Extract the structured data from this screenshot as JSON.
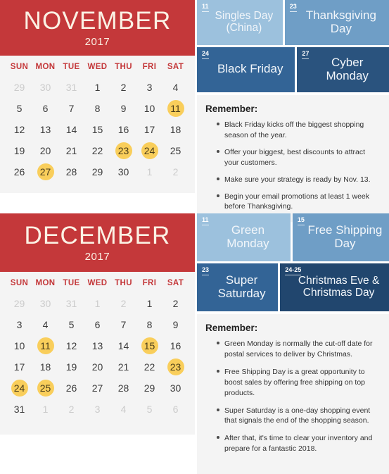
{
  "months": [
    {
      "id": "november",
      "name": "NOVEMBER",
      "year": "2017",
      "dow": [
        "SUN",
        "MON",
        "TUE",
        "WED",
        "THU",
        "FRI",
        "SAT"
      ],
      "weeks": [
        [
          {
            "n": "29",
            "state": "muted"
          },
          {
            "n": "30",
            "state": "muted"
          },
          {
            "n": "31",
            "state": "muted"
          },
          {
            "n": "1",
            "state": "normal"
          },
          {
            "n": "2",
            "state": "normal"
          },
          {
            "n": "3",
            "state": "normal"
          },
          {
            "n": "4",
            "state": "normal"
          }
        ],
        [
          {
            "n": "5",
            "state": "normal"
          },
          {
            "n": "6",
            "state": "normal"
          },
          {
            "n": "7",
            "state": "normal"
          },
          {
            "n": "8",
            "state": "normal"
          },
          {
            "n": "9",
            "state": "normal"
          },
          {
            "n": "10",
            "state": "normal"
          },
          {
            "n": "11",
            "state": "highlight"
          }
        ],
        [
          {
            "n": "12",
            "state": "normal"
          },
          {
            "n": "13",
            "state": "normal"
          },
          {
            "n": "14",
            "state": "normal"
          },
          {
            "n": "15",
            "state": "normal"
          },
          {
            "n": "16",
            "state": "normal"
          },
          {
            "n": "17",
            "state": "normal"
          },
          {
            "n": "18",
            "state": "normal"
          }
        ],
        [
          {
            "n": "19",
            "state": "normal"
          },
          {
            "n": "20",
            "state": "normal"
          },
          {
            "n": "21",
            "state": "normal"
          },
          {
            "n": "22",
            "state": "normal"
          },
          {
            "n": "23",
            "state": "highlight"
          },
          {
            "n": "24",
            "state": "highlight"
          },
          {
            "n": "25",
            "state": "normal"
          }
        ],
        [
          {
            "n": "26",
            "state": "normal"
          },
          {
            "n": "27",
            "state": "highlight"
          },
          {
            "n": "28",
            "state": "normal"
          },
          {
            "n": "29",
            "state": "normal"
          },
          {
            "n": "30",
            "state": "normal"
          },
          {
            "n": "1",
            "state": "muted"
          },
          {
            "n": "2",
            "state": "muted"
          }
        ]
      ],
      "event_rows": [
        [
          {
            "date": "11",
            "title": "Singles Day (China)",
            "tone": "tone-light",
            "flex": 120,
            "size": "sz-s"
          },
          {
            "date": "23",
            "title": "Thanksgiving Day",
            "tone": "tone-mid",
            "flex": 150,
            "size": ""
          }
        ],
        [
          {
            "date": "24",
            "title": "Black Friday",
            "tone": "tone-dark",
            "flex": 140,
            "size": ""
          },
          {
            "date": "27",
            "title": "Cyber Monday",
            "tone": "tone-darker",
            "flex": 130,
            "size": ""
          }
        ]
      ],
      "remember_title": "Remember:",
      "remember_items": [
        "Black Friday kicks off the biggest shopping season of the year.",
        "Offer your biggest, best discounts to attract your customers.",
        "Make sure your strategy is ready by Nov. 13.",
        "Begin your email promotions at least 1 week before Thanksgiving."
      ]
    },
    {
      "id": "december",
      "name": "DECEMBER",
      "year": "2017",
      "dow": [
        "SUN",
        "MON",
        "TUE",
        "WED",
        "THU",
        "FRI",
        "SAT"
      ],
      "weeks": [
        [
          {
            "n": "29",
            "state": "muted"
          },
          {
            "n": "30",
            "state": "muted"
          },
          {
            "n": "31",
            "state": "muted"
          },
          {
            "n": "1",
            "state": "muted"
          },
          {
            "n": "2",
            "state": "muted"
          },
          {
            "n": "1",
            "state": "normal"
          },
          {
            "n": "2",
            "state": "normal"
          }
        ],
        [
          {
            "n": "3",
            "state": "normal"
          },
          {
            "n": "4",
            "state": "normal"
          },
          {
            "n": "5",
            "state": "normal"
          },
          {
            "n": "6",
            "state": "normal"
          },
          {
            "n": "7",
            "state": "normal"
          },
          {
            "n": "8",
            "state": "normal"
          },
          {
            "n": "9",
            "state": "normal"
          }
        ],
        [
          {
            "n": "10",
            "state": "normal"
          },
          {
            "n": "11",
            "state": "highlight"
          },
          {
            "n": "12",
            "state": "normal"
          },
          {
            "n": "13",
            "state": "normal"
          },
          {
            "n": "14",
            "state": "normal"
          },
          {
            "n": "15",
            "state": "highlight"
          },
          {
            "n": "16",
            "state": "normal"
          }
        ],
        [
          {
            "n": "17",
            "state": "normal"
          },
          {
            "n": "18",
            "state": "normal"
          },
          {
            "n": "19",
            "state": "normal"
          },
          {
            "n": "20",
            "state": "normal"
          },
          {
            "n": "21",
            "state": "normal"
          },
          {
            "n": "22",
            "state": "normal"
          },
          {
            "n": "23",
            "state": "highlight"
          }
        ],
        [
          {
            "n": "24",
            "state": "highlight"
          },
          {
            "n": "25",
            "state": "highlight"
          },
          {
            "n": "26",
            "state": "normal"
          },
          {
            "n": "27",
            "state": "normal"
          },
          {
            "n": "28",
            "state": "normal"
          },
          {
            "n": "29",
            "state": "normal"
          },
          {
            "n": "30",
            "state": "normal"
          }
        ],
        [
          {
            "n": "31",
            "state": "normal"
          },
          {
            "n": "1",
            "state": "muted"
          },
          {
            "n": "2",
            "state": "muted"
          },
          {
            "n": "3",
            "state": "muted"
          },
          {
            "n": "4",
            "state": "muted"
          },
          {
            "n": "5",
            "state": "muted"
          },
          {
            "n": "6",
            "state": "muted"
          }
        ]
      ],
      "event_rows": [
        [
          {
            "date": "11",
            "title": "Green Monday",
            "tone": "tone-light",
            "flex": 140,
            "size": ""
          },
          {
            "date": "15",
            "title": "Free Shipping Day",
            "tone": "tone-mid",
            "flex": 145,
            "size": ""
          }
        ],
        [
          {
            "date": "23",
            "title": "Super Saturday",
            "tone": "tone-dark",
            "flex": 118,
            "size": ""
          },
          {
            "date": "24-25",
            "title": "Christmas Eve & Christmas Day",
            "tone": "tone-navy",
            "flex": 165,
            "size": "sz-s"
          }
        ]
      ],
      "remember_title": "Remember:",
      "remember_items": [
        "Green Monday is normally the cut-off date for postal services to deliver by Christmas.",
        "Free Shipping Day is a great opportunity to boost sales by offering free shipping on top products.",
        "Super Saturday is a one-day shopping event that signals the end of the shopping season.",
        "After that, it's time to clear your inventory and prepare for a fantastic 2018."
      ]
    }
  ],
  "colors": {
    "header_red": "#c4383a",
    "header_text": "#fbf1e4",
    "panel_bg": "#f4f4f4",
    "highlight": "#f9ce5b",
    "dow_red": "#c4383a",
    "muted_day": "#cbcbcb",
    "blue_light": "#9cc1dd",
    "blue_mid": "#6f9ec6",
    "blue_dark": "#336496",
    "blue_darker": "#2a537e",
    "blue_navy": "#21466e"
  }
}
